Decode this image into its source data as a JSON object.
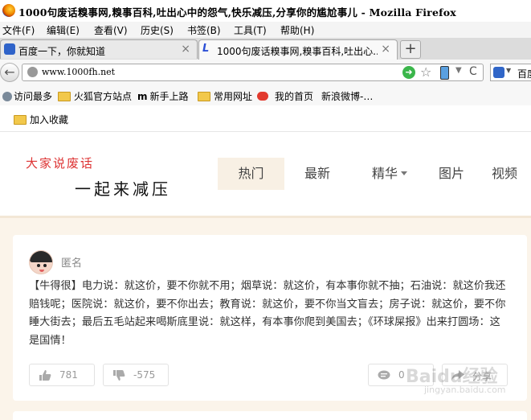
{
  "window": {
    "title": "1000句废话糗事网,糗事百科,吐出心中的怨气,快乐减压,分享你的尴尬事儿 - Mozilla Firefox"
  },
  "menu": [
    "文件(F)",
    "编辑(E)",
    "查看(V)",
    "历史(S)",
    "书签(B)",
    "工具(T)",
    "帮助(H)"
  ],
  "tabs": [
    {
      "label": "百度一下，你就知道",
      "close": "×"
    },
    {
      "label": "1000句废话糗事网,糗事百科,吐出心...",
      "close": "×"
    }
  ],
  "newtab": "+",
  "nav": {
    "back": "←",
    "url": "www.1000fh.net",
    "go": "➜",
    "star": "☆",
    "dropdown": "▼",
    "reload": "C",
    "search_text": "百度"
  },
  "bookmarks": [
    "访问最多",
    "火狐官方站点",
    "新手上路",
    "常用网址",
    "我的首页",
    "新浪微博-…"
  ],
  "add_bookmark": "加入收藏",
  "site": {
    "logo_top": "大家说废话",
    "logo_bottom": "一起来减压",
    "nav": [
      "热门",
      "最新",
      "精华",
      "图片",
      "视频"
    ]
  },
  "post": {
    "author": "匿名",
    "content": "【牛得很】电力说：就这价，要不你就不用；烟草说：就这价，有本事你就不抽；石油说：就这价我还赔钱呢；医院说：就这价，要不你出去；教育说：就这价，要不你当文盲去；房子说：就这价，要不你睡大街去；最后五毛站起来喝斯底里说：就这样，有本事你爬到美国去；《环球屎报》出来打圆场：这是国情！",
    "likes": "781",
    "dislikes": "-575",
    "comments": "0",
    "share": "分享"
  },
  "watermark": {
    "main": "Baidu经验",
    "sub": "jingyan.baidu.com"
  },
  "colors": {
    "accent_red": "#dd3333",
    "active_nav_bg": "#f8f0e4",
    "page_bg": "#fbf4ea"
  }
}
